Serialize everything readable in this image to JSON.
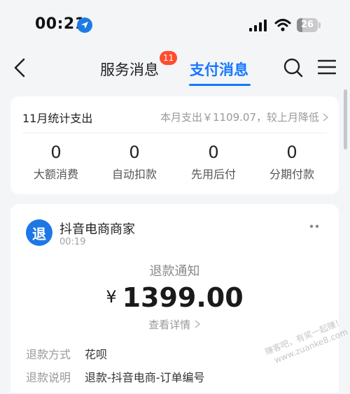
{
  "status_bar": {
    "time": "00:21",
    "battery": "26",
    "battery_level": 0.26
  },
  "nav": {
    "tabs": [
      {
        "label": "服务消息",
        "badge": "11",
        "active": false
      },
      {
        "label": "支付消息",
        "active": true
      }
    ],
    "accent_color": "#1677ff"
  },
  "summary": {
    "title": "11月统计支出",
    "spend_text": "本月支出￥1109.07，较上月降低",
    "stats": [
      {
        "value": "0",
        "label": "大额消费"
      },
      {
        "value": "0",
        "label": "自动扣款"
      },
      {
        "value": "0",
        "label": "先用后付"
      },
      {
        "value": "0",
        "label": "分期付款"
      }
    ]
  },
  "message": {
    "avatar_char": "退",
    "merchant": "抖音电商商家",
    "time": "00:19",
    "notice_title": "退款通知",
    "currency": "¥",
    "amount": "1399.00",
    "detail_link": "查看详情",
    "rows": [
      {
        "label": "退款方式",
        "value": "花呗"
      },
      {
        "label": "退款说明",
        "value": "退款-抖音电商-订单编号"
      }
    ]
  },
  "watermark": {
    "line1": "赚客吧，有奖一起赚！",
    "line2": "www.zuanke8.com"
  }
}
